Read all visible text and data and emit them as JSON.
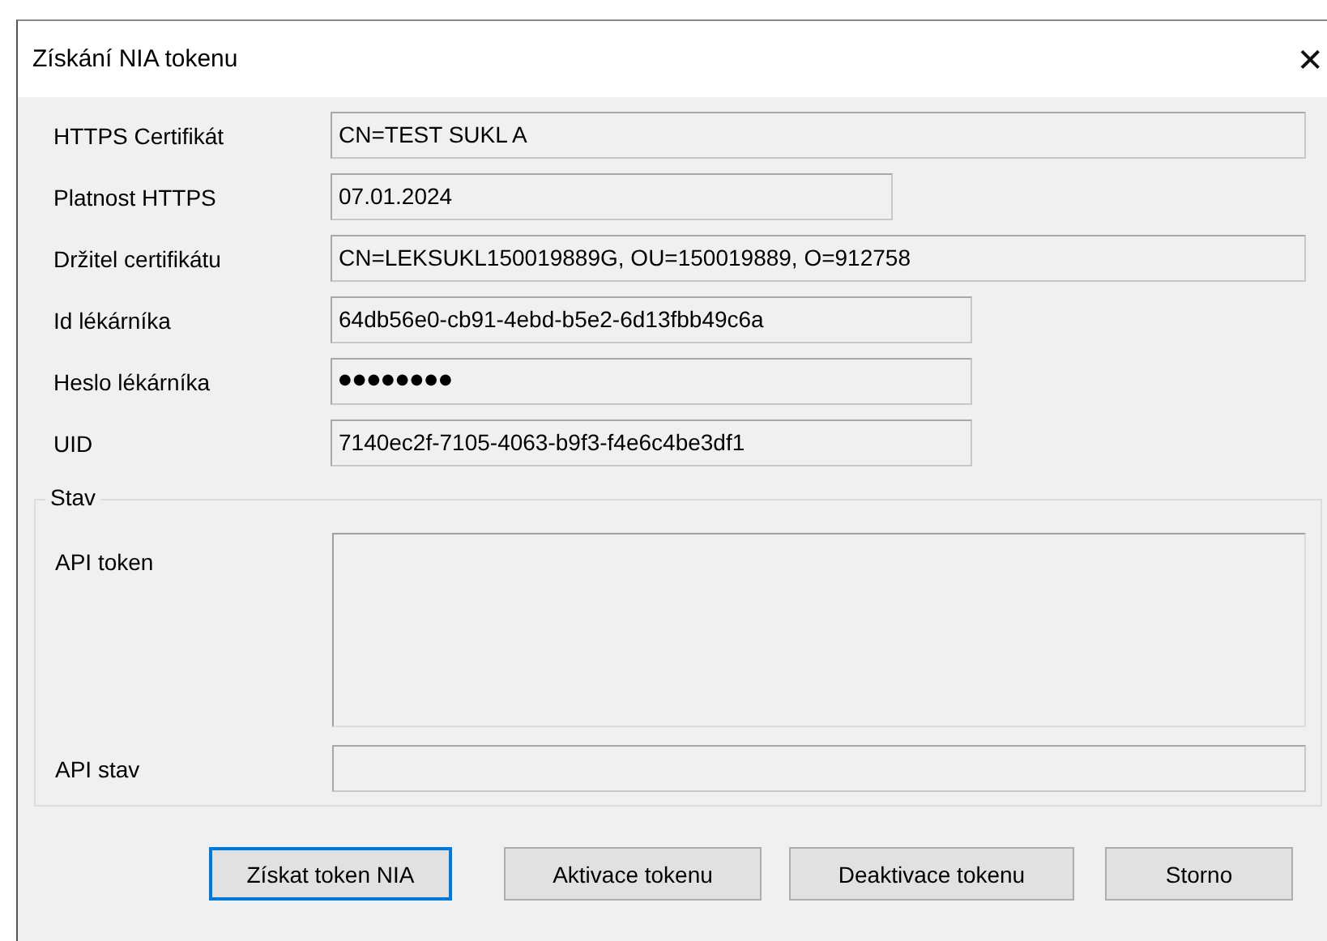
{
  "window": {
    "title": "Získání NIA tokenu",
    "close": "✕"
  },
  "fields": [
    {
      "label": "HTTPS Certifikát",
      "value": "CN=TEST SUKL A"
    },
    {
      "label": "Platnost HTTPS",
      "value": "07.01.2024"
    },
    {
      "label": "Držitel certifikátu",
      "value": "CN=LEKSUKL150019889G, OU=150019889, O=912758"
    },
    {
      "label": "Id lékárníka",
      "value": "64db56e0-cb91-4ebd-b5e2-6d13fbb49c6a"
    },
    {
      "label": "Heslo lékárníka",
      "value": "●●●●●●●●"
    },
    {
      "label": "UID",
      "value": "7140ec2f-7105-4063-b9f3-f4e6c4be3df1"
    }
  ],
  "status_group": {
    "title": "Stav",
    "api_token_label": "API token",
    "api_state_label": "API stav"
  },
  "buttons": [
    {
      "label": "Získat token NIA",
      "focused": true
    },
    {
      "label": "Aktivace tokenu",
      "focused": false
    },
    {
      "label": "Deaktivace tokenu",
      "focused": false
    },
    {
      "label": "Storno",
      "focused": false
    }
  ]
}
